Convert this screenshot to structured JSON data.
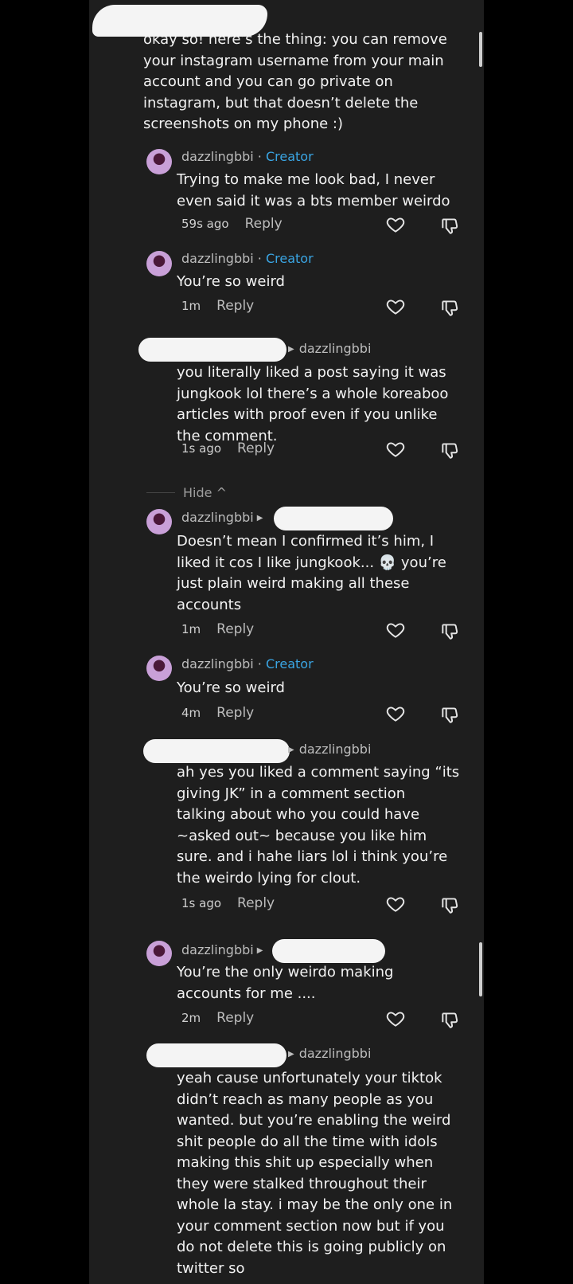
{
  "comments": [
    {
      "text": "okay so! here’s the thing: you can remove\nyour instagram username from your main\naccount and you can go private on\ninstagram, but that doesn’t delete the\nscreenshots on my phone :)"
    },
    {
      "author": "dazzlingbbi",
      "badge": "Creator",
      "text": "Trying to make me look bad, I never\neven said it was a bts member weirdo",
      "time": "59s ago",
      "reply": "Reply"
    },
    {
      "author": "dazzlingbbi",
      "badge": "Creator",
      "text": "You’re so weird",
      "time": "1m",
      "reply": "Reply"
    },
    {
      "reply_to": "dazzlingbbi",
      "text": "you literally liked a post saying it was\njungkook lol there’s a whole koreaboo\narticles with proof even if you unlike\nthe comment.",
      "time": "1s ago",
      "reply": "Reply"
    },
    {
      "author": "dazzlingbbi",
      "text": "Doesn’t mean I confirmed it’s him, I\nliked it cos I like jungkook... 💀 you’re\njust plain weird making all these\naccounts",
      "time": "1m",
      "reply": "Reply"
    },
    {
      "author": "dazzlingbbi",
      "badge": "Creator",
      "text": "You’re so weird",
      "time": "4m",
      "reply": "Reply"
    },
    {
      "reply_to": "dazzlingbbi",
      "text": "ah yes you liked a comment saying “its\ngiving JK” in a comment section\ntalking about who you could have\n~asked out~ because you like him\nsure. and i hahe liars lol i think you’re\nthe weirdo lying for clout.",
      "time": "1s ago",
      "reply": "Reply"
    },
    {
      "author": "dazzlingbbi",
      "text": "You’re the only weirdo making\naccounts for me ....",
      "time": "2m",
      "reply": "Reply"
    },
    {
      "reply_to": "dazzlingbbi",
      "text": "yeah cause unfortunately your tiktok\ndidn’t reach as many people as you\nwanted. but you’re enabling the weird\nshit people do all the time with idols\nmaking this shit up especially when\nthey were stalked throughout their\nwhole la stay. i may be the only one in\nyour comment section now but if you\ndo not delete this is going publicly on\ntwitter so"
    }
  ],
  "hide_label": "Hide ^",
  "badge_separator": " · ",
  "colors": {
    "creator_badge": "#3aa5e3",
    "panel": "#1e1e1e",
    "background": "#000000"
  },
  "icons": {
    "like": "heart-outline-icon",
    "dislike": "thumbs-down-outline-icon",
    "reply_arrow": "triangle-right-icon"
  }
}
